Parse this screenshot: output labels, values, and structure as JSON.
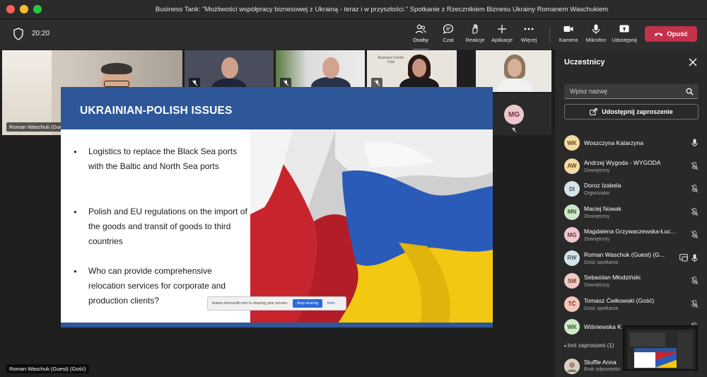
{
  "window": {
    "title": "Business Tank: \"Możliwości współpracy biznesowej z Ukrainą - teraz i w przyszłości.\" Spotkanie z Rzecznikiem Biznesu Ukrainy Romanem Waschukiem"
  },
  "toolbar": {
    "timer": "20:20",
    "people_label": "Osoby",
    "chat_label": "Czat",
    "reactions_label": "Reakcje",
    "apps_label": "Aplikacje",
    "more_label": "Więcej",
    "camera_label": "Kamera",
    "mic_label": "Mikrofon",
    "share_label": "Udostępnij",
    "leave_label": "Opuść",
    "leave_color": "#c4314b",
    "accent_color": "#7f85f5"
  },
  "stage": {
    "main_speaker_tag": "Roman Waschuk (Guest) (Gość)",
    "bottom_tag": "Roman Waschuk (Guest) (Gość)",
    "mg_initials": "MG",
    "banner_text": "Business Centre Club"
  },
  "slide": {
    "title": "UKRAINIAN-POLISH ISSUES",
    "header_color": "#2d5799",
    "bullets": [
      "Logistics to replace the Black Sea ports with the Baltic and North Sea ports",
      "Polish and EU regulations on the import of the goods and transit of goods to third countries",
      "Who can provide comprehensive relocation services for corporate and production clients?"
    ],
    "share_notice": "teams.microsoft.com is sharing your screen.",
    "stop_label": "Stop sharing",
    "hide_label": "Hide"
  },
  "panel": {
    "title": "Uczestnicy",
    "search_placeholder": "Wpisz nazwę",
    "invite_label": "Udostępnij zaproszenie",
    "participants": [
      {
        "initials": "WK",
        "name": "Woszczyna Katarzyna",
        "role": "",
        "bg": "#f3d9a4",
        "fg": "#6b4c10",
        "mic": "on"
      },
      {
        "initials": "AW",
        "name": "Andrzej Wygoda - WYGODA",
        "role": "Zewnętrzny",
        "bg": "#f3d9a4",
        "fg": "#6b4c10",
        "mic": "off"
      },
      {
        "initials": "DI",
        "name": "Doroz Izabela",
        "role": "Organizator",
        "bg": "#d6e4e8",
        "fg": "#3c5a64",
        "mic": "off"
      },
      {
        "initials": "MN",
        "name": "Maciej Nowak",
        "role": "Zewnętrzny",
        "bg": "#cfe8c8",
        "fg": "#2f5a26",
        "mic": "off"
      },
      {
        "initials": "MG",
        "name": "Magdalena Grzywaczewska-Łuc...",
        "role": "Zewnętrzny",
        "bg": "#ecc8cc",
        "fg": "#7a2e3a",
        "mic": "off"
      },
      {
        "initials": "RW",
        "name": "Roman Waschuk (Guest) (G...",
        "role": "Gość spotkania",
        "bg": "#d6e4e8",
        "fg": "#3c5a64",
        "mic": "on"
      },
      {
        "initials": "SM",
        "name": "Sebastian Młodziński",
        "role": "Zewnętrzny",
        "bg": "#ecccc4",
        "fg": "#7a3b2e",
        "mic": "off"
      },
      {
        "initials": "TĆ",
        "name": "Tomasz Ćwikowski (Gość)",
        "role": "Gość spotkania",
        "bg": "#f3c6b8",
        "fg": "#7a2e1a",
        "mic": "off"
      },
      {
        "initials": "WK",
        "name": "Wiśniewska K",
        "role": "",
        "bg": "#cfe8c8",
        "fg": "#2f5a26",
        "mic": "off"
      }
    ],
    "invited_header": "Inni zaproszeni (1)",
    "invited": {
      "name": "Stuffle Anna",
      "role": "Brak odpowiedzi"
    }
  }
}
